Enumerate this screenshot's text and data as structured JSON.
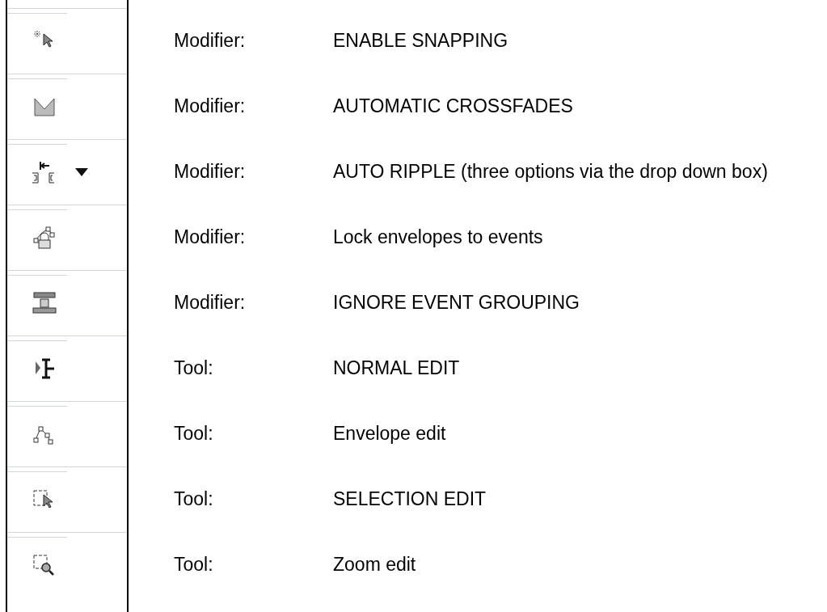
{
  "rows": [
    {
      "dropdown": false,
      "label": "Modifier:",
      "description": "ENABLE SNAPPING"
    },
    {
      "dropdown": false,
      "label": "Modifier:",
      "description": "AUTOMATIC CROSSFADES"
    },
    {
      "dropdown": true,
      "label": "Modifier:",
      "description": "AUTO RIPPLE (three options via the drop down box)"
    },
    {
      "dropdown": false,
      "label": "Modifier:",
      "description": "Lock envelopes to events"
    },
    {
      "dropdown": false,
      "label": "Modifier:",
      "description": "IGNORE EVENT GROUPING"
    },
    {
      "dropdown": false,
      "label": "Tool:",
      "description": "NORMAL EDIT"
    },
    {
      "dropdown": false,
      "label": "Tool:",
      "description": "Envelope edit"
    },
    {
      "dropdown": false,
      "label": "Tool:",
      "description": "SELECTION EDIT"
    },
    {
      "dropdown": false,
      "label": "Tool:",
      "description": "Zoom edit"
    }
  ]
}
